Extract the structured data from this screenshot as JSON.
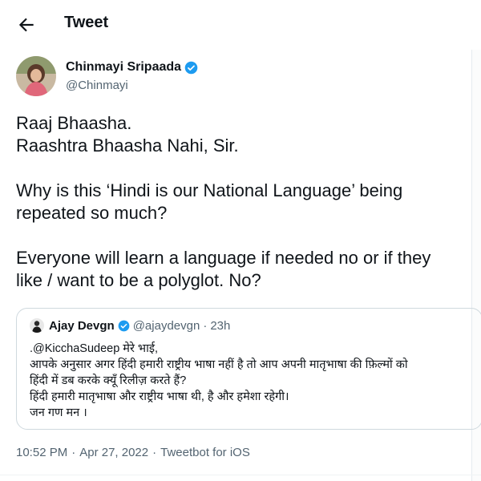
{
  "header": {
    "title": "Tweet",
    "back_icon": "arrow-left-icon"
  },
  "author": {
    "name": "Chinmayi Sripaada",
    "handle": "@Chinmayi",
    "verified_color": "#1d9bf0"
  },
  "tweet": {
    "lines": [
      "Raaj Bhaasha.",
      "Raashtra Bhaasha Nahi, Sir.",
      "",
      "Why is this ‘Hindi is our National Language’ being",
      "repeated so much?",
      "",
      "Everyone will learn a language if needed no or if they",
      "like / want to be a polyglot. No?"
    ]
  },
  "quote": {
    "name": "Ajay Devgn",
    "handle": "@ajaydevgn",
    "time": "23h",
    "dot": "·",
    "lines": [
      ".@KicchaSudeep मेरे भाई,",
      "आपके अनुसार अगर हिंदी हमारी राष्ट्रीय भाषा नहीं है तो आप अपनी मातृभाषा की फ़िल्मों को",
      "हिंदी में डब करके क्यूँ रिलीज़ करते हैं?",
      "हिंदी हमारी मातृभाषा और राष्ट्रीय भाषा थी, है और हमेशा रहेगी।",
      "जन गण मन ।"
    ]
  },
  "meta": {
    "time": "10:52 PM",
    "sep": "·",
    "date": "Apr 27, 2022",
    "source": "Tweetbot for iOS"
  },
  "colors": {
    "text": "#0f1419",
    "secondary": "#536471",
    "accent": "#1d9bf0",
    "border": "#cfd9de"
  }
}
